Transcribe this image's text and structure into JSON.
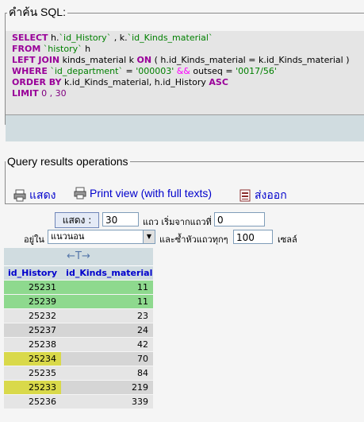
{
  "sql_panel": {
    "legend": "คำค้น SQL:",
    "lines": [
      {
        "k1": "SELECT",
        "t1": " h.",
        "b1": "`id_History`",
        "t2": " , k.",
        "b2": "`id_Kinds_material`"
      },
      {
        "k1": "FROM",
        "t1": " ",
        "b1": "`history`",
        "t2": " h"
      },
      {
        "k1": "LEFT JOIN",
        "t1": " kinds_material k ",
        "k2": "ON",
        "t3": " ( h.id_Kinds_material = k.id_Kinds_material )"
      },
      {
        "k1": "WHERE",
        "t1": " ",
        "b1": "`id_department`",
        "t2": " = ",
        "s1": "'000003'",
        "o1": " && ",
        "t3": "outseq = ",
        "s2": "'0017/56'"
      },
      {
        "k1": "ORDER BY",
        "t1": " k.id_Kinds_material, h.id_History ",
        "k2": "ASC"
      },
      {
        "k1": "LIMIT",
        "n1": " 0 , 30"
      }
    ]
  },
  "operations": {
    "legend": "Query results operations",
    "items": [
      {
        "label": "แสดง",
        "icon": "printer-icon"
      },
      {
        "label": "Print view (with full texts)",
        "icon": "printer-icon"
      },
      {
        "label": "ส่งออก",
        "icon": "export-icon"
      }
    ]
  },
  "nav": {
    "show_button": "แสดง :",
    "rows_value": "30",
    "rows_label": "แถว เริ่มจากแถวที่",
    "start_value": "0",
    "in_label": "อยู่ใน",
    "mode_value": "แนวนอน",
    "repeat_label": "และซ้ำหัวแถวทุกๆ",
    "repeat_value": "100",
    "cells_label": "เซลล์"
  },
  "grid": {
    "arrows": "←T→",
    "columns": [
      "id_History",
      "id_Kinds_material"
    ],
    "rows": [
      {
        "id_History": "25231",
        "id_Kinds_material": "11",
        "state": "selected"
      },
      {
        "id_History": "25239",
        "id_Kinds_material": "11",
        "state": "selected"
      },
      {
        "id_History": "25232",
        "id_Kinds_material": "23",
        "state": "odd"
      },
      {
        "id_History": "25237",
        "id_Kinds_material": "24",
        "state": "even"
      },
      {
        "id_History": "25238",
        "id_Kinds_material": "42",
        "state": "odd"
      },
      {
        "id_History": "25234",
        "id_Kinds_material": "70",
        "state": "even-marked"
      },
      {
        "id_History": "25235",
        "id_Kinds_material": "84",
        "state": "odd"
      },
      {
        "id_History": "25233",
        "id_Kinds_material": "219",
        "state": "even-marked"
      },
      {
        "id_History": "25236",
        "id_Kinds_material": "339",
        "state": "odd"
      }
    ]
  },
  "colors": {
    "keyword": "#990099",
    "identifier": "#008000",
    "link": "#0000cc",
    "selected_row": "#8ed98e",
    "marked_cell": "#d9d94a"
  }
}
